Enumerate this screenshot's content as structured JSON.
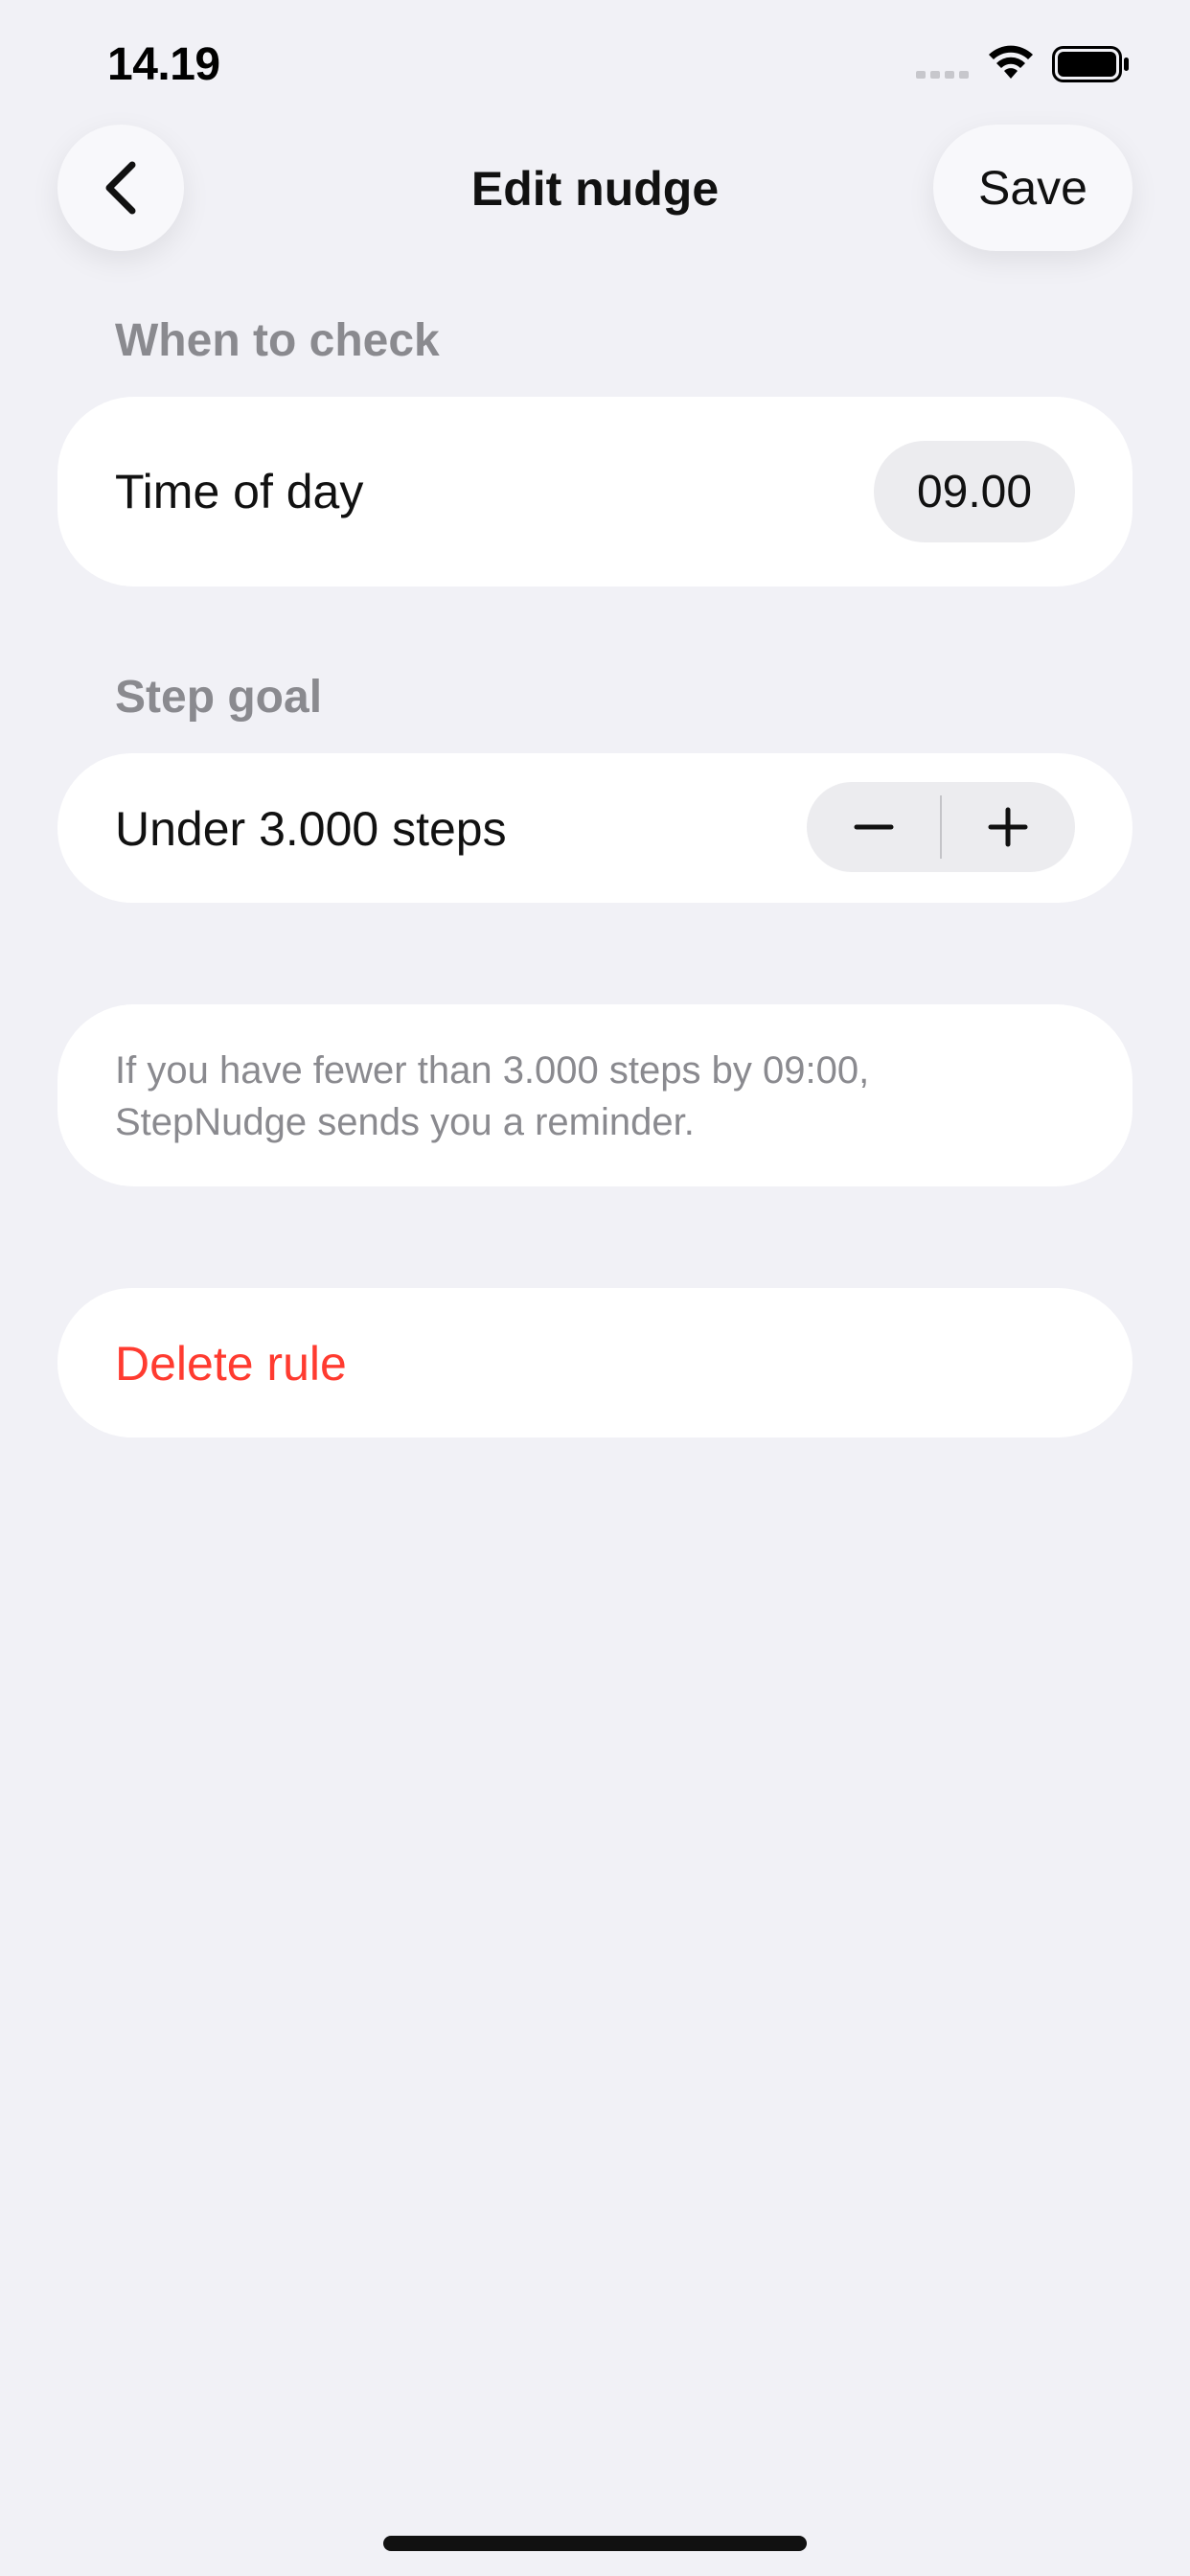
{
  "status_bar": {
    "time": "14.19"
  },
  "header": {
    "title": "Edit nudge",
    "save_label": "Save"
  },
  "when_section": {
    "label": "When to check",
    "row_label": "Time of day",
    "time_value": "09.00"
  },
  "goal_section": {
    "label": "Step goal",
    "row_label": "Under 3.000 steps"
  },
  "info": {
    "line1": "If you have fewer than 3.000 steps by 09:00,",
    "line2": "StepNudge sends you a reminder."
  },
  "delete": {
    "label": "Delete rule"
  },
  "colors": {
    "background": "#f1f1f6",
    "card": "#ffffff",
    "destructive": "#ff3b30",
    "secondary_text": "#8a8a8f"
  },
  "icons": {
    "back": "chevron-left-icon",
    "decrement": "minus-icon",
    "increment": "plus-icon",
    "wifi": "wifi-icon",
    "battery": "battery-icon",
    "signal": "signal-icon"
  }
}
